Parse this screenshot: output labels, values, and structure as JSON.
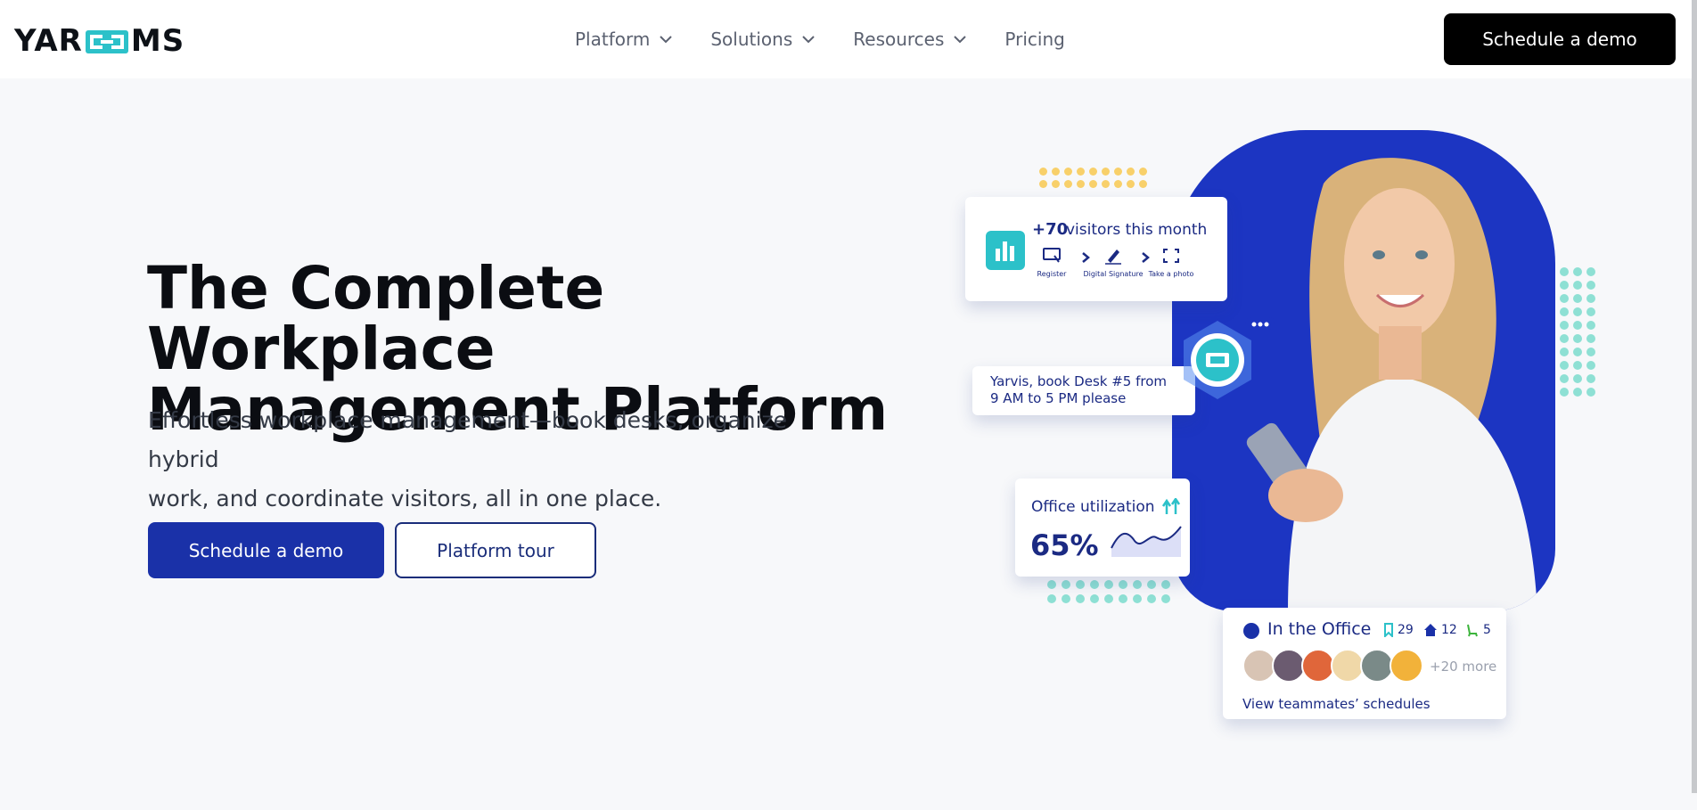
{
  "header": {
    "logo_text_left": "YAR",
    "logo_text_right": "MS",
    "nav": [
      {
        "label": "Platform",
        "has_dropdown": true
      },
      {
        "label": "Solutions",
        "has_dropdown": true
      },
      {
        "label": "Resources",
        "has_dropdown": true
      },
      {
        "label": "Pricing",
        "has_dropdown": false
      }
    ],
    "cta_label": "Schedule a demo"
  },
  "hero": {
    "title_line1": "The Complete Workplace",
    "title_line2": "Management Platform",
    "subtitle_line1": "Effortless workplace management—book desks, organize hybrid",
    "subtitle_line2": "work, and coordinate visitors, all in one place.",
    "primary_button": "Schedule a demo",
    "secondary_button": "Platform tour"
  },
  "illustration": {
    "visitors_card": {
      "count": "+70",
      "text": "visitors this month",
      "steps": [
        {
          "icon": "register-icon",
          "label": "Register"
        },
        {
          "icon": "signature-icon",
          "label": "Digital Signature"
        },
        {
          "icon": "photo-frame-icon",
          "label": "Take a photo"
        }
      ]
    },
    "yarvis_card": {
      "line1": "Yarvis, book Desk #5 from",
      "line2": "9 AM to 5 PM please"
    },
    "utilization_card": {
      "label": "Office utilization",
      "value": "65%"
    },
    "office_card": {
      "title": "In the Office",
      "desks": "29",
      "remote": "12",
      "leave": "5",
      "more": "+20 more",
      "link": "View teammates’ schedules"
    }
  },
  "colors": {
    "brand_blue": "#1a31a8",
    "arch_blue": "#1c35c2",
    "teal": "#2cc1c9",
    "dot_yellow": "#f8d06a",
    "dot_teal": "#8ee0d4",
    "text_navy": "#1b2a83"
  }
}
